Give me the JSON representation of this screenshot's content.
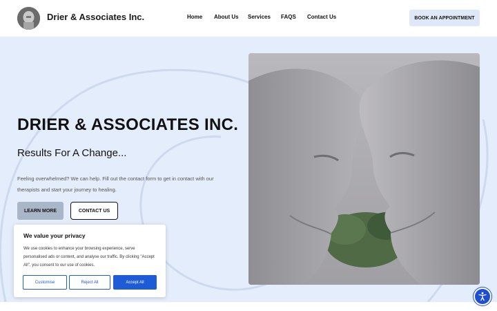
{
  "header": {
    "brand": "Drier & Associates Inc.",
    "logo_icon": "practice-logo",
    "nav": [
      "Home",
      "About Us",
      "Services",
      "FAQS",
      "Contact Us"
    ],
    "cta": "BOOK AN APPOINTMENT"
  },
  "hero": {
    "title": "DRIER & ASSOCIATES INC.",
    "subtitle": "Results For A Change...",
    "description": "Feeling overwhelmed? We can help. Fill out the contact form to get in contact  with our therapists and start your journey to healing.",
    "learn_more": "LEARN MORE",
    "contact": "CONTACT US",
    "image_icon": "stone-sculpture-faces"
  },
  "cookie": {
    "title": "We value your privacy",
    "text": "We use cookies to enhance your browsing experience, serve personalised ads or content, and analyse our traffic. By clicking \"Accept All\", you consent to our use of cookies.",
    "customise": "Customise",
    "reject": "Reject All",
    "accept": "Accept All"
  },
  "colors": {
    "hero_bg": "#e4edfb",
    "accent_blue": "#1e5bd6",
    "book_btn_bg": "#dfe8f8",
    "learn_btn_bg": "#a9b6c8"
  },
  "accessibility": {
    "icon": "accessibility-icon"
  }
}
